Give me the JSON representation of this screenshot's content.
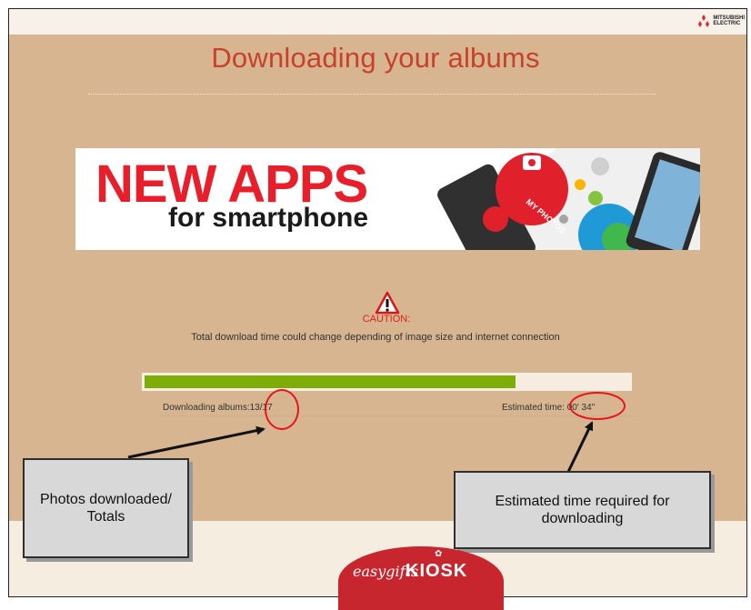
{
  "brand": {
    "name_line1": "MITSUBISHI",
    "name_line2": "ELECTRIC",
    "accent_color": "#e81e2a"
  },
  "page": {
    "title": "Downloading your albums"
  },
  "banner": {
    "line1": "NEW APPS",
    "line2": "for smartphone",
    "art_label": "MY PHOTOS"
  },
  "caution": {
    "icon": "warning-triangle-icon",
    "title": "CAUTION:",
    "message": "Total download time could change depending of image size and internet connection"
  },
  "progress": {
    "fraction": 0.765,
    "downloading_label": "Downloading albums:",
    "downloaded": "13/17",
    "estimated_label": "Estimated time:",
    "estimated_value": "00' 34''",
    "fill_color": "#7dad06"
  },
  "annotations": {
    "photos_callout": "Photos downloaded/ Totals",
    "time_callout": "Estimated time required for downloading"
  },
  "footer": {
    "logo_word1": "easygifts",
    "logo_word2": "KIOSK"
  }
}
